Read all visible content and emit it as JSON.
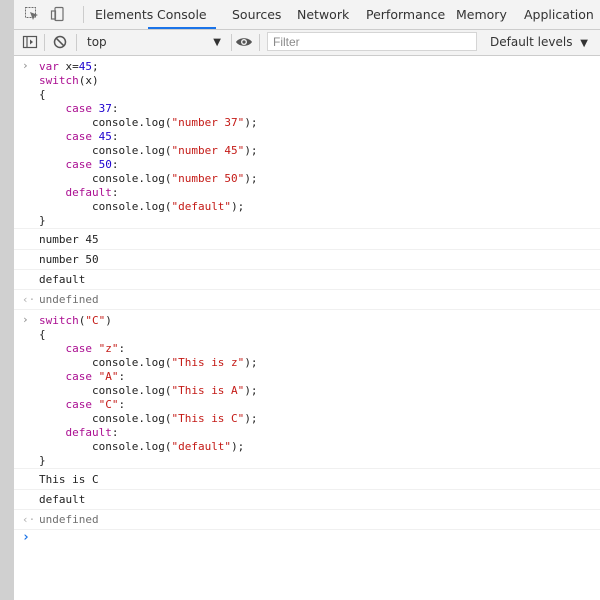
{
  "tabs": [
    {
      "label": "Elements"
    },
    {
      "label": "Console"
    },
    {
      "label": "Sources"
    },
    {
      "label": "Network"
    },
    {
      "label": "Performance"
    },
    {
      "label": "Memory"
    },
    {
      "label": "Application"
    }
  ],
  "active_tab": "Console",
  "toolbar": {
    "context": "top",
    "filter_placeholder": "Filter",
    "levels_label": "Default levels"
  },
  "console": {
    "block1": {
      "code": [
        [
          "var x=45;"
        ],
        [
          "switch(x)"
        ],
        [
          "{"
        ],
        [
          "    case 37:"
        ],
        [
          "        console.log(\"number 37\");"
        ],
        [
          "    case 45:"
        ],
        [
          "        console.log(\"number 45\");"
        ],
        [
          "    case 50:"
        ],
        [
          "        console.log(\"number 50\");"
        ],
        [
          "    default:"
        ],
        [
          "        console.log(\"default\");"
        ],
        [
          "}"
        ]
      ],
      "outputs": [
        "number 45",
        "number 50",
        "default"
      ],
      "return": "undefined"
    },
    "block2": {
      "code": [
        [
          "switch(\"C\")"
        ],
        [
          "{"
        ],
        [
          "    case \"z\":"
        ],
        [
          "        console.log(\"This is z\");"
        ],
        [
          "    case \"A\":"
        ],
        [
          "        console.log(\"This is A\");"
        ],
        [
          "    case \"C\":"
        ],
        [
          "        console.log(\"This is C\");"
        ],
        [
          "    default:"
        ],
        [
          "        console.log(\"default\");"
        ],
        [
          "}"
        ]
      ],
      "outputs": [
        "This is C",
        "default"
      ],
      "return": "undefined"
    }
  },
  "colors": {
    "keyword": "#aa0d91",
    "number": "#1c00cf",
    "string": "#c41a16",
    "active_tab_underline": "#1a73e8"
  },
  "icons": [
    "inspect-element-icon",
    "device-toolbar-icon",
    "sidebar-toggle-icon",
    "clear-console-icon",
    "eye-icon",
    "chevron-right-icon",
    "return-arrow-icon"
  ]
}
